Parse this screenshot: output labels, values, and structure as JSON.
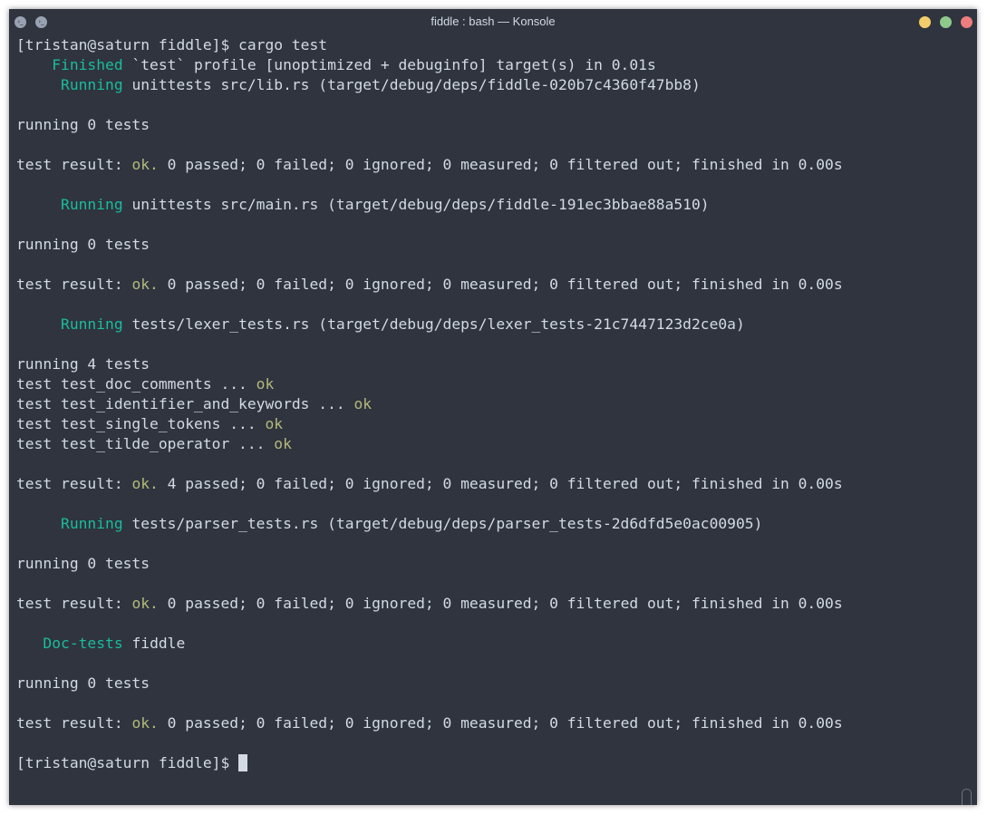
{
  "window": {
    "title": "fiddle : bash — Konsole",
    "left_icon_1": "›_",
    "left_icon_2": "›_",
    "controls": [
      {
        "name": "minimize",
        "color": "#f4cd6b"
      },
      {
        "name": "maximize",
        "color": "#8fc88b"
      },
      {
        "name": "close",
        "color": "#ee7d7f"
      }
    ]
  },
  "colors": {
    "background": "#2f343f",
    "text": "#d3dae3",
    "accent_green": "#1abc9c",
    "ok_yellow": "#b4b97a"
  },
  "terminal": {
    "prompt1": "[tristan@saturn fiddle]$ cargo test",
    "finished_label": "Finished",
    "finished_rest": " `test` profile [unoptimized + debuginfo] target(s) in 0.01s",
    "running_label": "Running",
    "doctests_label": "Doc-tests",
    "run1": " unittests src/lib.rs (target/debug/deps/fiddle-020b7c4360f47bb8)",
    "running0": "running 0 tests",
    "result_prefix": "test result: ",
    "ok": "ok",
    "ok_dot": "ok.",
    "res_zero": " 0 passed; 0 failed; 0 ignored; 0 measured; 0 filtered out; finished in 0.00s",
    "res_four": " 4 passed; 0 failed; 0 ignored; 0 measured; 0 filtered out; finished in 0.00s",
    "run2": " unittests src/main.rs (target/debug/deps/fiddle-191ec3bbae88a510)",
    "run3": " tests/lexer_tests.rs (target/debug/deps/lexer_tests-21c7447123d2ce0a)",
    "running4": "running 4 tests",
    "tests": [
      "test test_doc_comments ... ",
      "test test_identifier_and_keywords ... ",
      "test test_single_tokens ... ",
      "test test_tilde_operator ... "
    ],
    "run4": " tests/parser_tests.rs (target/debug/deps/parser_tests-2d6dfd5e0ac00905)",
    "doctests_rest": " fiddle",
    "prompt2": "[tristan@saturn fiddle]$ "
  }
}
